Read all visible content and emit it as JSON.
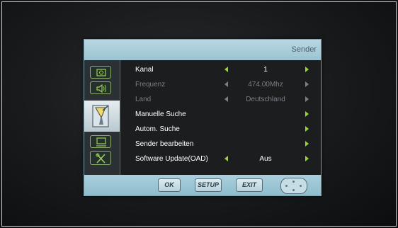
{
  "menu": {
    "title": "Sender",
    "sidebar": [
      {
        "icon": "picture-icon"
      },
      {
        "icon": "sound-icon"
      },
      {
        "icon": "satellite-dish-icon",
        "active": true
      },
      {
        "icon": "screen-icon"
      },
      {
        "icon": "tools-icon"
      }
    ],
    "rows": [
      {
        "label": "Kanal",
        "value": "1",
        "enabled": true
      },
      {
        "label": "Frequenz",
        "value": "474.00Mhz",
        "enabled": false
      },
      {
        "label": "Land",
        "value": "Deutschland",
        "enabled": false
      },
      {
        "label": "Manuelle Suche",
        "value": "",
        "enabled": true
      },
      {
        "label": "Autom. Suche",
        "value": "",
        "enabled": true
      },
      {
        "label": "Sender bearbeiten",
        "value": "",
        "enabled": true
      },
      {
        "label": "Software Update(OAD)",
        "value": "Aus",
        "enabled": true
      }
    ],
    "footer": {
      "ok_label": "OK",
      "setup_label": "SETUP",
      "exit_label": "EXIT"
    }
  },
  "colors": {
    "accent_arrow": "#98d62a",
    "title_bar": "#a9cfdd",
    "panel_bg": "#1b1d1f"
  }
}
